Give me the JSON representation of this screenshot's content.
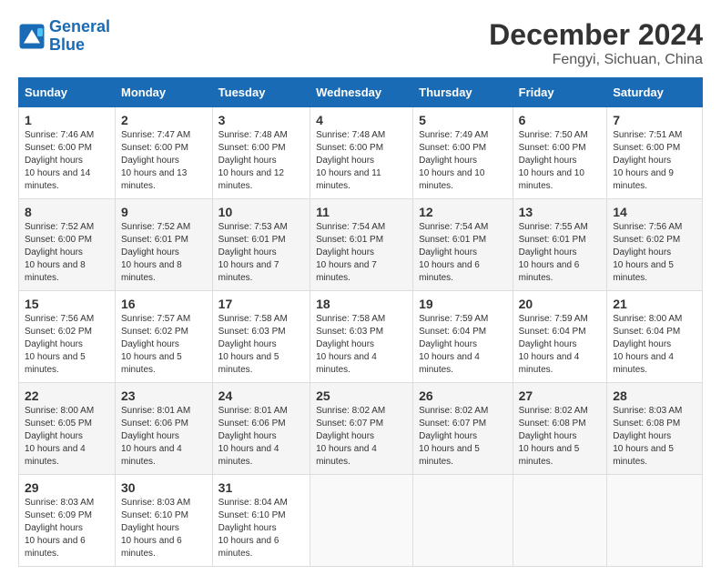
{
  "header": {
    "logo_line1": "General",
    "logo_line2": "Blue",
    "month": "December 2024",
    "location": "Fengyi, Sichuan, China"
  },
  "weekdays": [
    "Sunday",
    "Monday",
    "Tuesday",
    "Wednesday",
    "Thursday",
    "Friday",
    "Saturday"
  ],
  "weeks": [
    [
      {
        "day": "1",
        "sunrise": "7:46 AM",
        "sunset": "6:00 PM",
        "daylight": "10 hours and 14 minutes."
      },
      {
        "day": "2",
        "sunrise": "7:47 AM",
        "sunset": "6:00 PM",
        "daylight": "10 hours and 13 minutes."
      },
      {
        "day": "3",
        "sunrise": "7:48 AM",
        "sunset": "6:00 PM",
        "daylight": "10 hours and 12 minutes."
      },
      {
        "day": "4",
        "sunrise": "7:48 AM",
        "sunset": "6:00 PM",
        "daylight": "10 hours and 11 minutes."
      },
      {
        "day": "5",
        "sunrise": "7:49 AM",
        "sunset": "6:00 PM",
        "daylight": "10 hours and 10 minutes."
      },
      {
        "day": "6",
        "sunrise": "7:50 AM",
        "sunset": "6:00 PM",
        "daylight": "10 hours and 10 minutes."
      },
      {
        "day": "7",
        "sunrise": "7:51 AM",
        "sunset": "6:00 PM",
        "daylight": "10 hours and 9 minutes."
      }
    ],
    [
      {
        "day": "8",
        "sunrise": "7:52 AM",
        "sunset": "6:00 PM",
        "daylight": "10 hours and 8 minutes."
      },
      {
        "day": "9",
        "sunrise": "7:52 AM",
        "sunset": "6:01 PM",
        "daylight": "10 hours and 8 minutes."
      },
      {
        "day": "10",
        "sunrise": "7:53 AM",
        "sunset": "6:01 PM",
        "daylight": "10 hours and 7 minutes."
      },
      {
        "day": "11",
        "sunrise": "7:54 AM",
        "sunset": "6:01 PM",
        "daylight": "10 hours and 7 minutes."
      },
      {
        "day": "12",
        "sunrise": "7:54 AM",
        "sunset": "6:01 PM",
        "daylight": "10 hours and 6 minutes."
      },
      {
        "day": "13",
        "sunrise": "7:55 AM",
        "sunset": "6:01 PM",
        "daylight": "10 hours and 6 minutes."
      },
      {
        "day": "14",
        "sunrise": "7:56 AM",
        "sunset": "6:02 PM",
        "daylight": "10 hours and 5 minutes."
      }
    ],
    [
      {
        "day": "15",
        "sunrise": "7:56 AM",
        "sunset": "6:02 PM",
        "daylight": "10 hours and 5 minutes."
      },
      {
        "day": "16",
        "sunrise": "7:57 AM",
        "sunset": "6:02 PM",
        "daylight": "10 hours and 5 minutes."
      },
      {
        "day": "17",
        "sunrise": "7:58 AM",
        "sunset": "6:03 PM",
        "daylight": "10 hours and 5 minutes."
      },
      {
        "day": "18",
        "sunrise": "7:58 AM",
        "sunset": "6:03 PM",
        "daylight": "10 hours and 4 minutes."
      },
      {
        "day": "19",
        "sunrise": "7:59 AM",
        "sunset": "6:04 PM",
        "daylight": "10 hours and 4 minutes."
      },
      {
        "day": "20",
        "sunrise": "7:59 AM",
        "sunset": "6:04 PM",
        "daylight": "10 hours and 4 minutes."
      },
      {
        "day": "21",
        "sunrise": "8:00 AM",
        "sunset": "6:04 PM",
        "daylight": "10 hours and 4 minutes."
      }
    ],
    [
      {
        "day": "22",
        "sunrise": "8:00 AM",
        "sunset": "6:05 PM",
        "daylight": "10 hours and 4 minutes."
      },
      {
        "day": "23",
        "sunrise": "8:01 AM",
        "sunset": "6:06 PM",
        "daylight": "10 hours and 4 minutes."
      },
      {
        "day": "24",
        "sunrise": "8:01 AM",
        "sunset": "6:06 PM",
        "daylight": "10 hours and 4 minutes."
      },
      {
        "day": "25",
        "sunrise": "8:02 AM",
        "sunset": "6:07 PM",
        "daylight": "10 hours and 4 minutes."
      },
      {
        "day": "26",
        "sunrise": "8:02 AM",
        "sunset": "6:07 PM",
        "daylight": "10 hours and 5 minutes."
      },
      {
        "day": "27",
        "sunrise": "8:02 AM",
        "sunset": "6:08 PM",
        "daylight": "10 hours and 5 minutes."
      },
      {
        "day": "28",
        "sunrise": "8:03 AM",
        "sunset": "6:08 PM",
        "daylight": "10 hours and 5 minutes."
      }
    ],
    [
      {
        "day": "29",
        "sunrise": "8:03 AM",
        "sunset": "6:09 PM",
        "daylight": "10 hours and 6 minutes."
      },
      {
        "day": "30",
        "sunrise": "8:03 AM",
        "sunset": "6:10 PM",
        "daylight": "10 hours and 6 minutes."
      },
      {
        "day": "31",
        "sunrise": "8:04 AM",
        "sunset": "6:10 PM",
        "daylight": "10 hours and 6 minutes."
      },
      null,
      null,
      null,
      null
    ]
  ]
}
